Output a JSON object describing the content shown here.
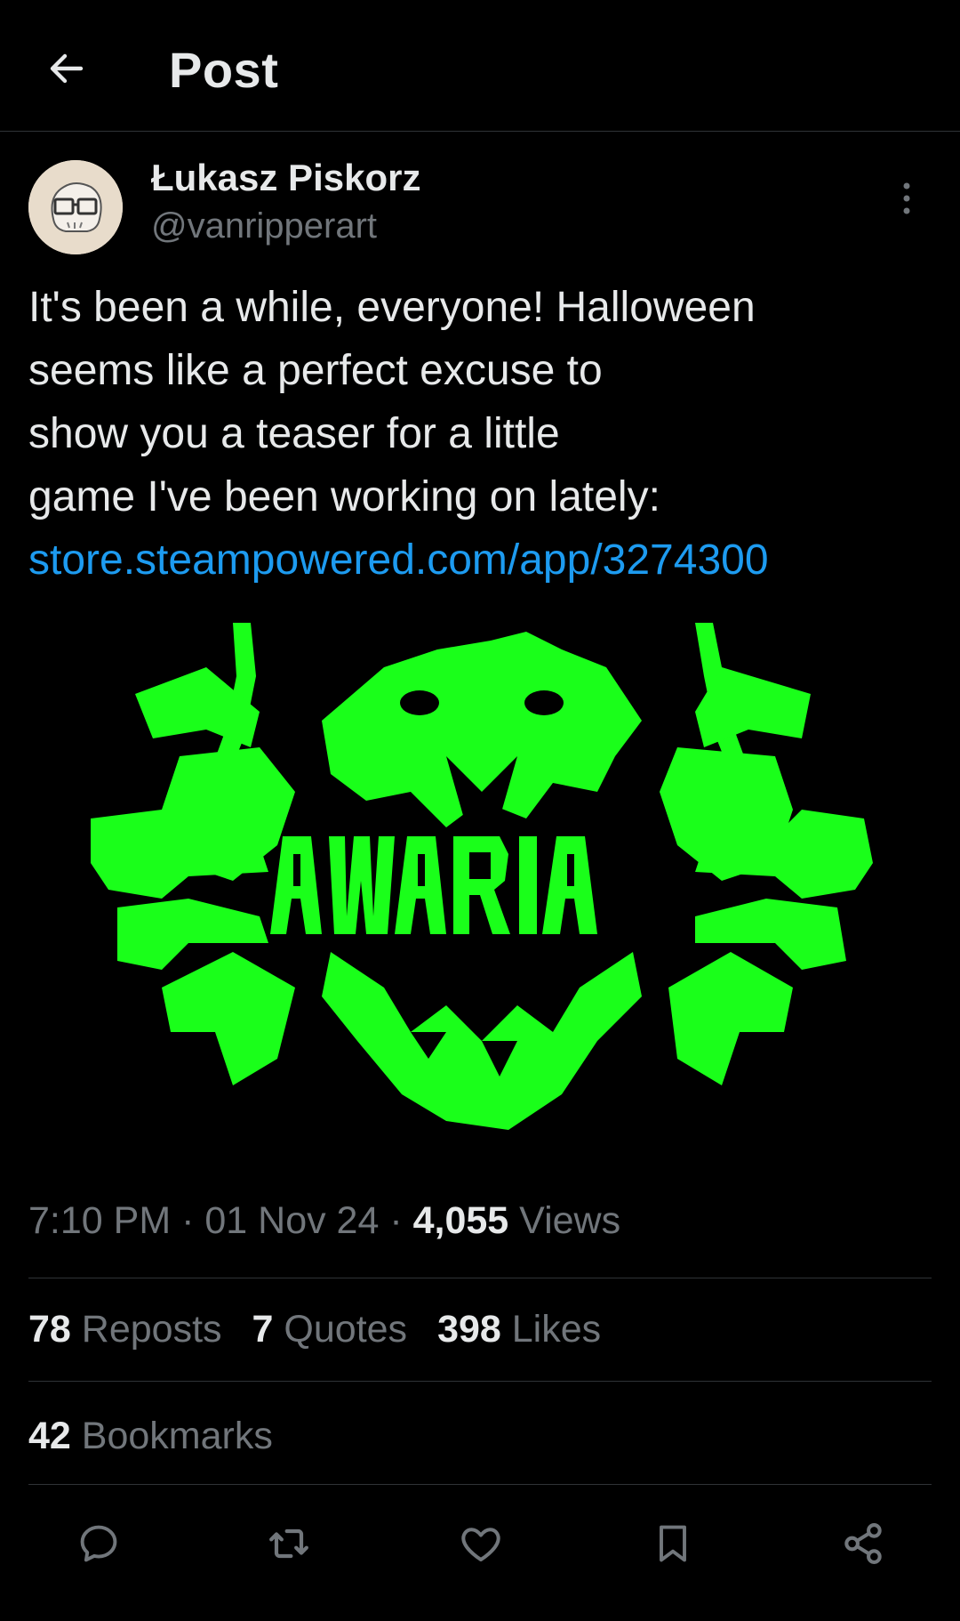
{
  "header": {
    "back_icon": "arrow-left-icon",
    "title": "Post"
  },
  "author": {
    "name": "Łukasz Piskorz",
    "handle": "@vanripperart",
    "avatar_icon": "skull-with-glasses-avatar"
  },
  "post": {
    "lines": [
      "It's been a while, everyone! Halloween",
      "seems like a perfect excuse to",
      "show you a teaser for a little",
      "game I've been working on lately:"
    ],
    "link": "store.steampowered.com/app/3274300",
    "image_text": "AWARIA"
  },
  "meta": {
    "time": "7:10 PM",
    "separator": " · ",
    "date": "01 Nov 24",
    "views_count": "4,055",
    "views_label": " Views"
  },
  "stats": [
    {
      "count": "78",
      "label": " Reposts"
    },
    {
      "count": "7",
      "label": " Quotes"
    },
    {
      "count": "398",
      "label": " Likes"
    }
  ],
  "bookmarks": {
    "count": "42",
    "label": " Bookmarks"
  },
  "actions": [
    "reply-icon",
    "repost-icon",
    "like-icon",
    "bookmark-icon",
    "share-icon"
  ],
  "colors": {
    "background": "#000000",
    "text": "#e7e9ea",
    "secondary": "#71767b",
    "link": "#1d9bf0",
    "logo_green": "#1aff1a"
  }
}
